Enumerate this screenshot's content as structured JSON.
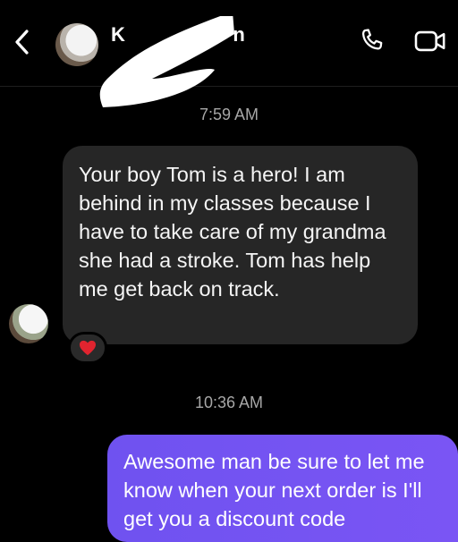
{
  "header": {
    "back_icon": "chevron-left-icon",
    "contact_name_visible": "K",
    "contact_name_tail": "n",
    "call_icon": "phone-icon",
    "video_icon": "video-camera-icon"
  },
  "messages": [
    {
      "timestamp": "7:59 AM",
      "direction": "incoming",
      "text": "Your boy Tom is a hero! I am behind in my classes because I have to take care of my grandma she had a stroke. Tom has help me get back on track.",
      "reaction": "❤️"
    },
    {
      "timestamp": "10:36 AM",
      "direction": "outgoing",
      "text": "Awesome man be sure to let me know when your next order is I'll get you a discount code"
    }
  ],
  "colors": {
    "background": "#000000",
    "incoming_bubble": "#262626",
    "outgoing_bubble": "#7453f2",
    "timestamp_text": "#a7a7a7"
  }
}
